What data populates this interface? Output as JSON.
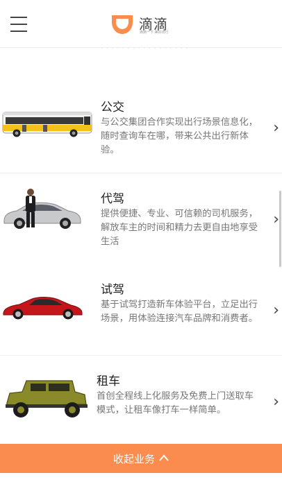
{
  "header": {
    "brand_name": "滴滴",
    "slogan": "滴滴一下 美好出行",
    "brand_color": "#fa8c4e"
  },
  "services": [
    {
      "title": "公交",
      "description": "与公交集团合作实现出行场景信息化，随时查询车在哪，带来公共出行新体验。",
      "icon": "bus-image"
    },
    {
      "title": "代驾",
      "description": "提供便捷、专业、可信赖的司机服务，解放车主的时间和精力去更自由地享受生活",
      "icon": "chauffeur-car-image"
    },
    {
      "title": "试驾",
      "description": "基于试驾打造新车体验平台，立足出行场景，用体验连接汽车品牌和消费者。",
      "icon": "red-sports-car-image"
    },
    {
      "title": "租车",
      "description": "首创全程线上化服务及免费上门送取车模式，让租车像打车一样简单。",
      "icon": "jeep-image"
    }
  ],
  "collapse": {
    "label": "收起业务",
    "icon": "chevron-up-icon"
  }
}
